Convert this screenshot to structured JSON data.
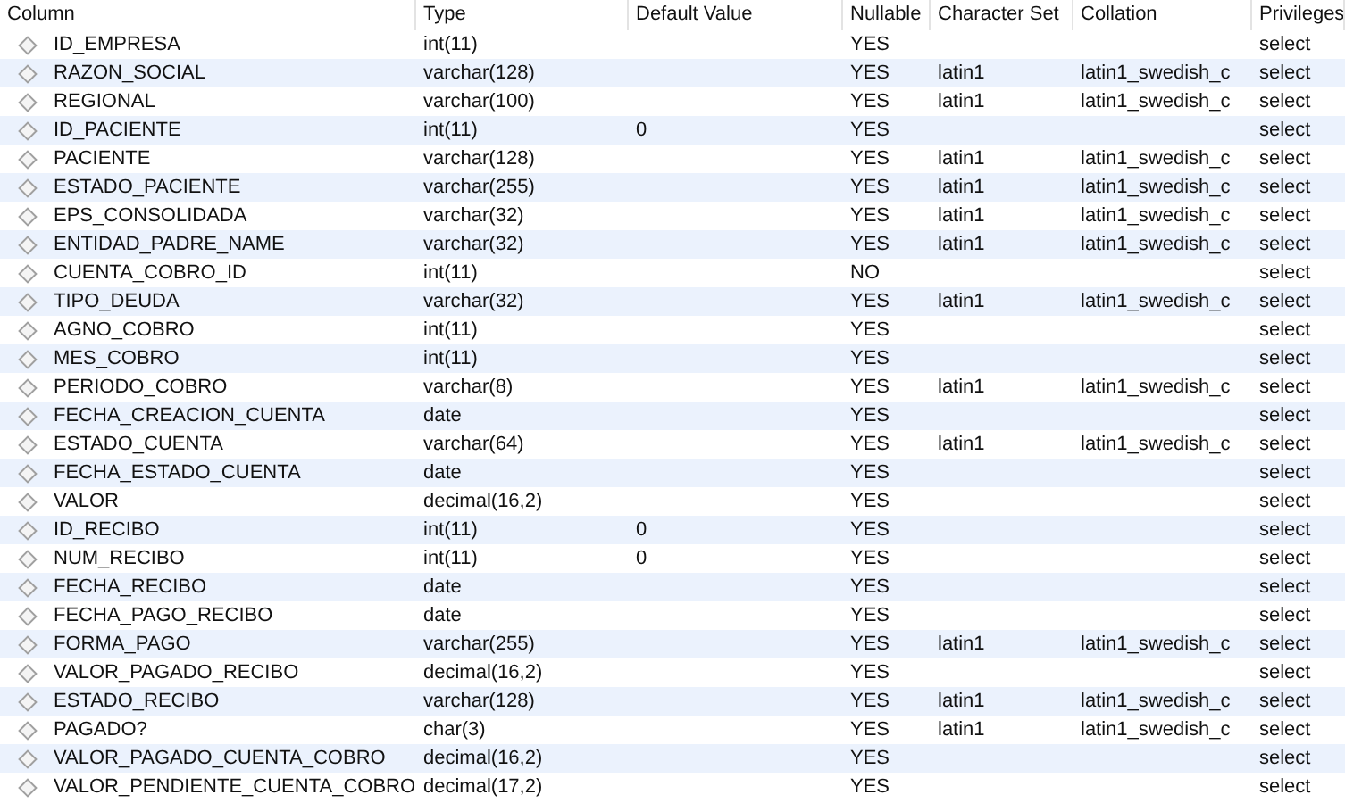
{
  "table": {
    "columns": [
      "Column",
      "Type",
      "Default Value",
      "Nullable",
      "Character Set",
      "Collation",
      "Privileges"
    ],
    "rows": [
      {
        "column": "ID_EMPRESA",
        "type": "int(11)",
        "nullable": "YES",
        "privileges": "select"
      },
      {
        "column": "RAZON_SOCIAL",
        "type": "varchar(128)",
        "nullable": "YES",
        "charset": "latin1",
        "collation": "latin1_swedish_c",
        "privileges": "select"
      },
      {
        "column": "REGIONAL",
        "type": "varchar(100)",
        "nullable": "YES",
        "charset": "latin1",
        "collation": "latin1_swedish_c",
        "privileges": "select"
      },
      {
        "column": "ID_PACIENTE",
        "type": "int(11)",
        "default": "0",
        "nullable": "YES",
        "privileges": "select"
      },
      {
        "column": "PACIENTE",
        "type": "varchar(128)",
        "nullable": "YES",
        "charset": "latin1",
        "collation": "latin1_swedish_c",
        "privileges": "select"
      },
      {
        "column": "ESTADO_PACIENTE",
        "type": "varchar(255)",
        "nullable": "YES",
        "charset": "latin1",
        "collation": "latin1_swedish_c",
        "privileges": "select"
      },
      {
        "column": "EPS_CONSOLIDADA",
        "type": "varchar(32)",
        "nullable": "YES",
        "charset": "latin1",
        "collation": "latin1_swedish_c",
        "privileges": "select"
      },
      {
        "column": "ENTIDAD_PADRE_NAME",
        "type": "varchar(32)",
        "nullable": "YES",
        "charset": "latin1",
        "collation": "latin1_swedish_c",
        "privileges": "select"
      },
      {
        "column": "CUENTA_COBRO_ID",
        "type": "int(11)",
        "nullable": "NO",
        "privileges": "select"
      },
      {
        "column": "TIPO_DEUDA",
        "type": "varchar(32)",
        "nullable": "YES",
        "charset": "latin1",
        "collation": "latin1_swedish_c",
        "privileges": "select"
      },
      {
        "column": "AGNO_COBRO",
        "type": "int(11)",
        "nullable": "YES",
        "privileges": "select"
      },
      {
        "column": "MES_COBRO",
        "type": "int(11)",
        "nullable": "YES",
        "privileges": "select"
      },
      {
        "column": "PERIODO_COBRO",
        "type": "varchar(8)",
        "nullable": "YES",
        "charset": "latin1",
        "collation": "latin1_swedish_c",
        "privileges": "select"
      },
      {
        "column": "FECHA_CREACION_CUENTA",
        "type": "date",
        "nullable": "YES",
        "privileges": "select"
      },
      {
        "column": "ESTADO_CUENTA",
        "type": "varchar(64)",
        "nullable": "YES",
        "charset": "latin1",
        "collation": "latin1_swedish_c",
        "privileges": "select"
      },
      {
        "column": "FECHA_ESTADO_CUENTA",
        "type": "date",
        "nullable": "YES",
        "privileges": "select"
      },
      {
        "column": "VALOR",
        "type": "decimal(16,2)",
        "nullable": "YES",
        "privileges": "select"
      },
      {
        "column": "ID_RECIBO",
        "type": "int(11)",
        "default": "0",
        "nullable": "YES",
        "privileges": "select"
      },
      {
        "column": "NUM_RECIBO",
        "type": "int(11)",
        "default": "0",
        "nullable": "YES",
        "privileges": "select"
      },
      {
        "column": "FECHA_RECIBO",
        "type": "date",
        "nullable": "YES",
        "privileges": "select"
      },
      {
        "column": "FECHA_PAGO_RECIBO",
        "type": "date",
        "nullable": "YES",
        "privileges": "select"
      },
      {
        "column": "FORMA_PAGO",
        "type": "varchar(255)",
        "nullable": "YES",
        "charset": "latin1",
        "collation": "latin1_swedish_c",
        "privileges": "select"
      },
      {
        "column": "VALOR_PAGADO_RECIBO",
        "type": "decimal(16,2)",
        "nullable": "YES",
        "privileges": "select"
      },
      {
        "column": "ESTADO_RECIBO",
        "type": "varchar(128)",
        "nullable": "YES",
        "charset": "latin1",
        "collation": "latin1_swedish_c",
        "privileges": "select"
      },
      {
        "column": "PAGADO?",
        "type": "char(3)",
        "nullable": "YES",
        "charset": "latin1",
        "collation": "latin1_swedish_c",
        "privileges": "select"
      },
      {
        "column": "VALOR_PAGADO_CUENTA_COBRO",
        "type": "decimal(16,2)",
        "nullable": "YES",
        "privileges": "select"
      },
      {
        "column": "VALOR_PENDIENTE_CUENTA_COBRO",
        "type": "decimal(17,2)",
        "nullable": "YES",
        "privileges": "select"
      }
    ]
  }
}
